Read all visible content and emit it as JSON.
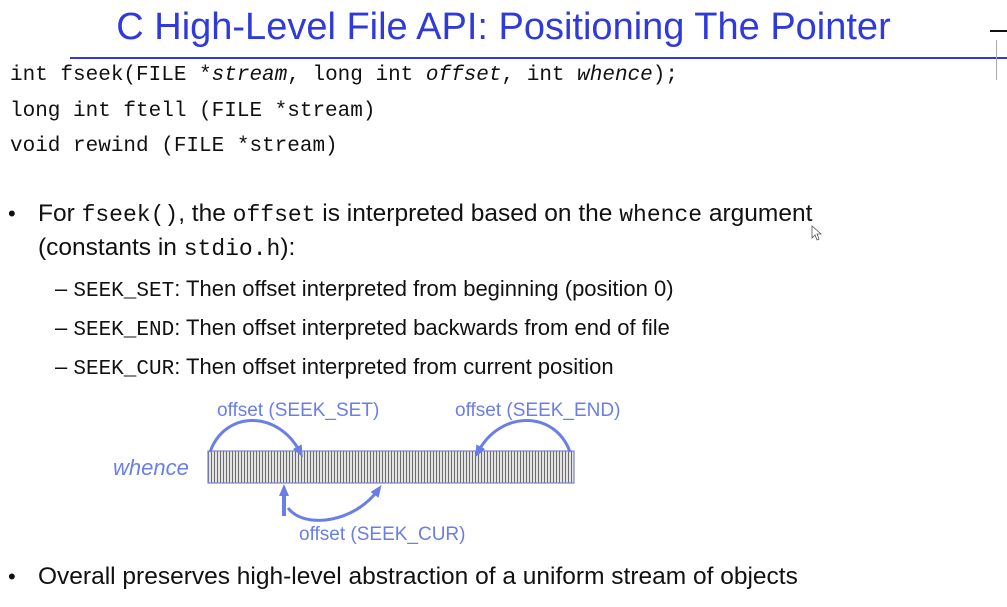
{
  "slide": {
    "title": "C High-Level File API: Positioning The Pointer"
  },
  "code": {
    "line1": {
      "pre1": "int fseek(FILE *",
      "arg1": "stream",
      "mid1": ", long int ",
      "arg2": "offset",
      "mid2": ", int ",
      "arg3": "whence",
      "post": ");"
    },
    "line2": "long int ftell (FILE *stream)",
    "line3": "void rewind (FILE *stream)"
  },
  "bullets": {
    "b1": {
      "dot": "•",
      "part1": "For ",
      "code1": "fseek()",
      "part2": ", the ",
      "code2": "offset",
      "part3": " is interpreted based on the ",
      "code3": "whence",
      "part4": " argument",
      "line2_part1": "(constants in ",
      "line2_code": "stdio.h",
      "line2_part2": "):"
    },
    "subs": [
      {
        "dash": "–",
        "code": "SEEK_SET",
        "text": ": Then offset interpreted from beginning (position 0)"
      },
      {
        "dash": "–",
        "code": "SEEK_END",
        "text": ": Then offset interpreted backwards from end of file"
      },
      {
        "dash": "–",
        "code": "SEEK_CUR",
        "text": ": Then offset interpreted from current position"
      }
    ],
    "b2": {
      "dot": "•",
      "text": "Overall preserves high-level abstraction of a uniform stream of objects"
    }
  },
  "diagram": {
    "whence_label": "whence",
    "label_set": "offset (SEEK_SET)",
    "label_end": "offset (SEEK_END)",
    "label_cur": "offset (SEEK_CUR)",
    "accent_color": "#6a7ee8",
    "stream_fill": "#d8d8d8"
  }
}
